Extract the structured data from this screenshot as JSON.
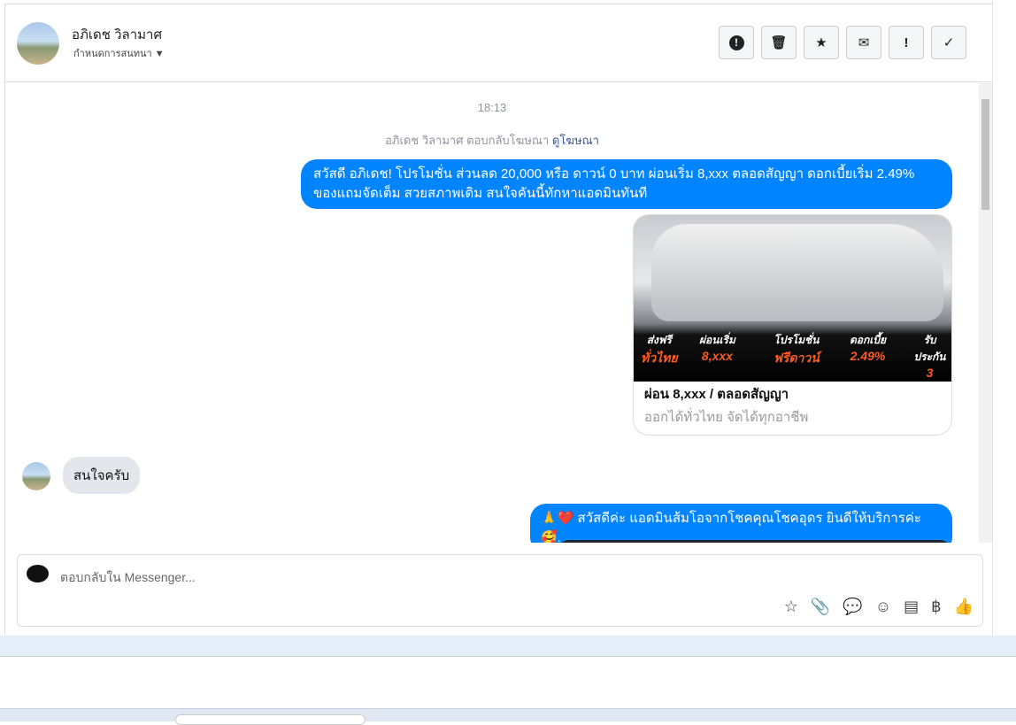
{
  "header": {
    "name": "อภิเดช วิลามาศ",
    "subtitle": "กำหนดการสนทนา",
    "tools": [
      {
        "icon": "alert-circle-icon",
        "glyph": "!"
      },
      {
        "icon": "trash-icon",
        "glyph": "🗑"
      },
      {
        "icon": "star-icon",
        "glyph": "★"
      },
      {
        "icon": "envelope-icon",
        "glyph": "✉"
      },
      {
        "icon": "exclamation-icon",
        "glyph": "!"
      },
      {
        "icon": "check-icon",
        "glyph": "✓"
      }
    ]
  },
  "messages": {
    "time": "18:13",
    "meta_text": "อภิเดช วิลามาศ ตอบกลับโฆษณา",
    "meta_link": "ดูโฆษณา",
    "out1": "สวัสดี อภิเดช! โปรโมชั่น ส่วนลด 20,000 หรือ ดาวน์ 0 บาท ผ่อนเริ่ม 8,xxx ตลอดสัญญา ดอกเบี้ยเริ่ม 2.49% ของแถมจัดเต็ม สวยสภาพเดิม สนใจคันนี้ทักหาแอดมินทันที",
    "card": {
      "title": "ผ่อน 8,xxx / ตลอดสัญญา",
      "subtitle": "ออกได้ทั่วไทย จัดได้ทุกอาชีพ",
      "promos": [
        {
          "label": "ส่งฟรี",
          "value": "ทั่วไทย"
        },
        {
          "label": "ผ่อนเริ่ม",
          "value": "8,xxx"
        },
        {
          "label": "โปรโมชั่น",
          "value": "ฟรีดาวน์"
        },
        {
          "label": "ดอกเบี้ย",
          "value": "2.49%"
        },
        {
          "label": "รับประกัน",
          "value": "3"
        }
      ]
    },
    "in1": "สนใจครับ",
    "out2": "🙏❤️ สวัสดีค่ะ แอดมินส้มโอจากโชคคุณโชคอุดร ยินดีให้บริการค่ะ 🥰."
  },
  "composer": {
    "placeholder": "ตอบกลับใน Messenger...",
    "icons": [
      {
        "icon": "saved-reply-icon",
        "glyph": "☆"
      },
      {
        "icon": "attachment-icon",
        "glyph": "📎"
      },
      {
        "icon": "chat-dots-icon",
        "glyph": "💬"
      },
      {
        "icon": "emoji-icon",
        "glyph": "☺"
      },
      {
        "icon": "notes-icon",
        "glyph": "▤"
      },
      {
        "icon": "baht-icon",
        "glyph": "฿"
      },
      {
        "icon": "thumbs-up-icon",
        "glyph": "👍"
      }
    ]
  }
}
